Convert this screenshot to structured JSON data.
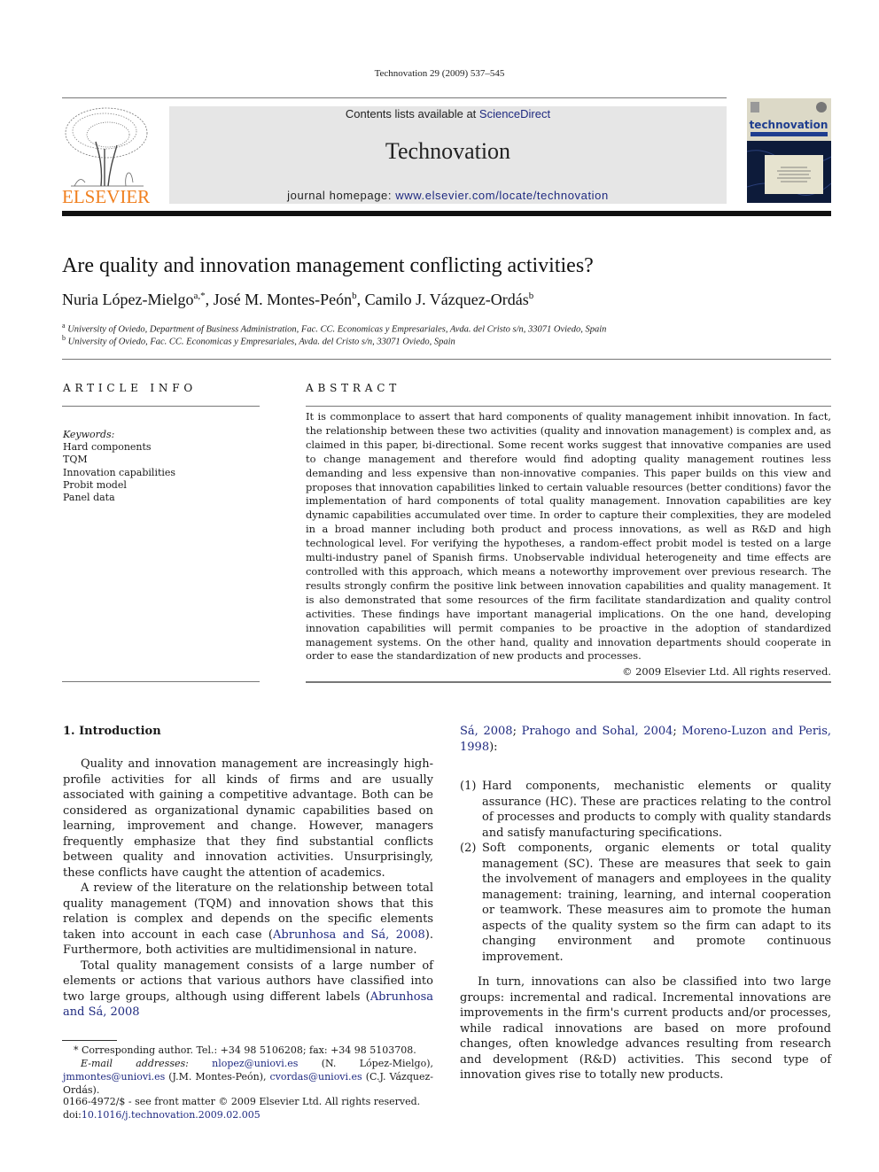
{
  "running_header": "Technovation 29 (2009) 537–545",
  "masthead": {
    "publisher_logo": "ELSEVIER",
    "publisher_logo_color": "#f07f1e",
    "contents_prefix": "Contents lists available at ",
    "contents_link": "ScienceDirect",
    "journal_title": "Technovation",
    "homepage_prefix": "journal homepage: ",
    "homepage_link": "www.elsevier.com/locate/technovation",
    "cover_title": "technovation",
    "link_color": "#1f2a80",
    "banner_color": "#e6e6e6"
  },
  "article": {
    "title": "Are quality and innovation management conflicting activities?",
    "authors": [
      {
        "name": "Nuria López-Mielgo",
        "marks": "a,*"
      },
      {
        "name": "José M. Montes-Peón",
        "marks": "b"
      },
      {
        "name": "Camilo J. Vázquez-Ordás",
        "marks": "b"
      }
    ],
    "affiliations": [
      {
        "mark": "a",
        "text": "University of Oviedo, Department of Business Administration, Fac. CC. Economicas y Empresariales, Avda. del Cristo s/n, 33071 Oviedo, Spain"
      },
      {
        "mark": "b",
        "text": "University of Oviedo, Fac. CC. Economicas y Empresariales, Avda. del Cristo s/n, 33071 Oviedo, Spain"
      }
    ]
  },
  "article_info": {
    "heading": "ARTICLE INFO",
    "keywords_label": "Keywords:",
    "keywords": [
      "Hard components",
      "TQM",
      "Innovation capabilities",
      "Probit model",
      "Panel data"
    ]
  },
  "abstract": {
    "heading": "ABSTRACT",
    "text": "It is commonplace to assert that hard components of quality management inhibit innovation. In fact, the relationship between these two activities (quality and innovation management) is complex and, as claimed in this paper, bi-directional. Some recent works suggest that innovative companies are used to change management and therefore would find adopting quality management routines less demanding and less expensive than non-innovative companies. This paper builds on this view and proposes that innovation capabilities linked to certain valuable resources (better conditions) favor the implementation of hard components of total quality management. Innovation capabilities are key dynamic capabilities accumulated over time. In order to capture their complexities, they are modeled in a broad manner including both product and process innovations, as well as R&D and high technological level. For verifying the hypotheses, a random-effect probit model is tested on a large multi-industry panel of Spanish firms. Unobservable individual heterogeneity and time effects are controlled with this approach, which means a noteworthy improvement over previous research. The results strongly confirm the positive link between innovation capabilities and quality management. It is also demonstrated that some resources of the firm facilitate standardization and quality control activities. These findings have important managerial implications. On the one hand, developing innovation capabilities will permit companies to be proactive in the adoption of standardized management systems. On the other hand, quality and innovation departments should cooperate in order to ease the standardization of new products and processes.",
    "copyright": "© 2009 Elsevier Ltd. All rights reserved."
  },
  "introduction": {
    "heading": "1.  Introduction",
    "p1": "Quality and innovation management are increasingly high-profile activities for all kinds of firms and are usually associated with gaining a competitive advantage. Both can be considered as organizational dynamic capabilities based on learning, improvement and change. However, managers frequently emphasize that they find substantial conflicts between quality and innovation activities. Unsurprisingly, these conflicts have caught the attention of academics.",
    "p2_before": "A review of the literature on the relationship between total quality management (TQM) and innovation shows that this relation is complex and depends on the specific elements taken into account in each case (",
    "p2_cite": "Abrunhosa and Sá, 2008",
    "p2_after": "). Furthermore, both activities are multidimensional in nature.",
    "p3_before": "Total quality management consists of a large number of elements or actions that various authors have classified into two large groups, although using different labels (",
    "p3_cite1": "Abrunhosa and Sá, 2008",
    "p3_sep1": "; ",
    "p3_cite2": "Prahogo and Sohal, 2004",
    "p3_sep2": "; ",
    "p3_cite3": "Moreno-Luzon and Peris, 1998",
    "p3_after": "):",
    "list": [
      {
        "num": "(1)",
        "text": "Hard components, mechanistic elements or quality assurance (HC). These are practices relating to the control of processes and products to comply with quality standards and satisfy manufacturing specifications."
      },
      {
        "num": "(2)",
        "text": "Soft components, organic elements or total quality management (SC). These are measures that seek to gain the involvement of managers and employees in the quality management: training, learning, and internal cooperation or teamwork. These measures aim to promote the human aspects of the quality system so the firm can adapt to its changing environment and promote continuous improvement."
      }
    ],
    "p4": "In turn, innovations can also be classified into two large groups: incremental and radical. Incremental innovations are improvements in the firm's current products and/or processes, while radical innovations are based on more profound changes, often knowledge advances resulting from research and development (R&D) activities. This second type of innovation gives rise to totally new products."
  },
  "footnotes": {
    "corresponding": "* Corresponding author. Tel.: +34 98 5106208; fax: +34 98 5103708.",
    "email_label": "E-mail addresses:",
    "emails": [
      {
        "address": "nlopez@uniovi.es",
        "owner": " (N. López-Mielgo), "
      },
      {
        "address": "jmmontes@uniovi.es",
        "owner": " (J.M. Montes-Peón), "
      },
      {
        "address": "cvordas@uniovi.es",
        "owner": " (C.J. Vázquez-Ordás)."
      }
    ],
    "front_matter": "0166-4972/$ - see front matter © 2009 Elsevier Ltd. All rights reserved.",
    "doi_label": "doi:",
    "doi": "10.1016/j.technovation.2009.02.005"
  }
}
